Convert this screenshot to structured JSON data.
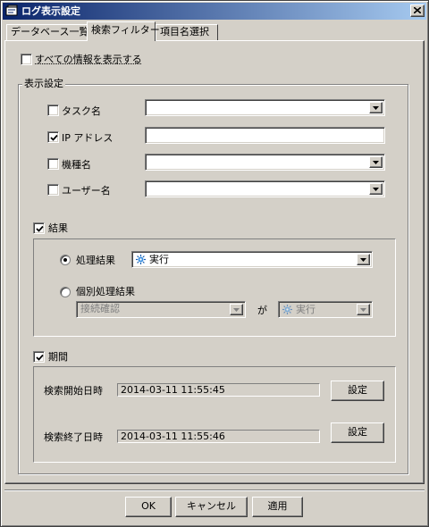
{
  "window": {
    "title": "ログ表示設定",
    "close_icon": "close-icon"
  },
  "tabs": [
    {
      "label": "データベース一覧",
      "active": false
    },
    {
      "label": "検索フィルター",
      "active": true
    },
    {
      "label": "項目名選択",
      "active": false
    }
  ],
  "show_all": {
    "label": "すべての情報を表示する",
    "checked": false
  },
  "display_settings": {
    "legend": "表示設定",
    "rows": [
      {
        "label": "タスク名",
        "checked": false,
        "kind": "combo",
        "value": ""
      },
      {
        "label": "IP アドレス",
        "checked": true,
        "kind": "text",
        "value": ""
      },
      {
        "label": "機種名",
        "checked": false,
        "kind": "combo",
        "value": ""
      },
      {
        "label": "ユーザー名",
        "checked": false,
        "kind": "combo",
        "value": ""
      }
    ]
  },
  "result": {
    "label": "結果",
    "checked": true,
    "process_result": {
      "label": "処理結果",
      "selected": true,
      "value": "実行",
      "icon": "gear-icon"
    },
    "individual_result": {
      "label": "個別処理結果",
      "selected": false,
      "target_value": "接続確認",
      "connector": "が",
      "value": "実行",
      "icon": "gear-icon"
    }
  },
  "period": {
    "label": "期間",
    "checked": true,
    "start": {
      "label": "検索開始日時",
      "value": "2014-03-11 11:55:45",
      "button": "設定"
    },
    "end": {
      "label": "検索終了日時",
      "value": "2014-03-11 11:55:46",
      "button": "設定"
    }
  },
  "footer": {
    "ok": "OK",
    "cancel": "キャンセル",
    "apply": "適用"
  },
  "colors": {
    "title_start": "#0a246a",
    "title_end": "#a6caf0",
    "face": "#d4d0c8"
  }
}
